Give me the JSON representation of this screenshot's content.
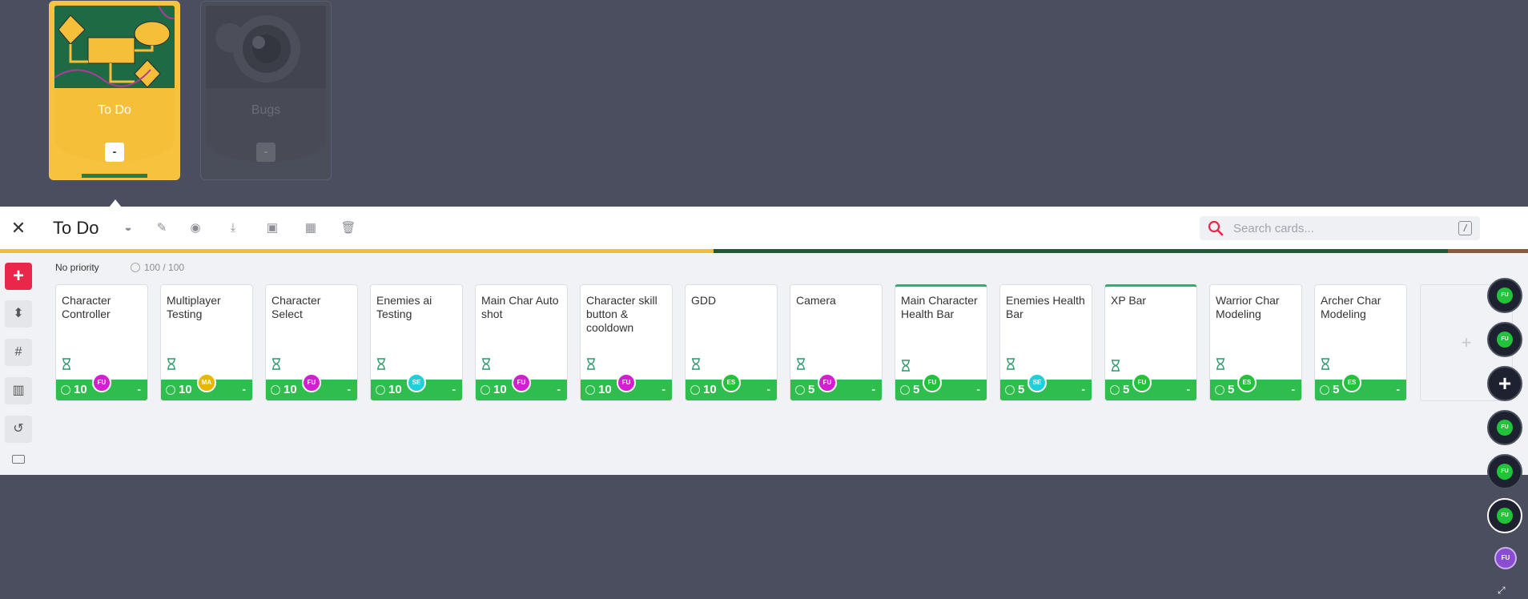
{
  "decks": [
    {
      "title": "To Do",
      "button": "-",
      "state": "selected"
    },
    {
      "title": "Bugs",
      "button": "-",
      "state": "inactive"
    }
  ],
  "header": {
    "title": "To Do",
    "close_icon": "close-icon",
    "tools": [
      "globe-icon",
      "pencil-icon",
      "eye-icon",
      "inbox-download-icon",
      "archive-icon",
      "calendar-icon",
      "trash-icon"
    ]
  },
  "search": {
    "placeholder": "Search cards...",
    "shortcut": "/"
  },
  "sidebar": [
    "add-icon",
    "sort-icon",
    "hash-icon",
    "chart-icon",
    "history-icon",
    "keyboard-icon"
  ],
  "lane": {
    "label": "No priority",
    "points": "100 / 100"
  },
  "cards": [
    {
      "title": "Character Controller",
      "points": "10",
      "avatar": "FU",
      "avatar_color": "#d21fd0",
      "dash": "-"
    },
    {
      "title": "Multiplayer Testing",
      "points": "10",
      "avatar": "MA",
      "avatar_color": "#e6b800",
      "dash": "-"
    },
    {
      "title": "Character Select",
      "points": "10",
      "avatar": "FU",
      "avatar_color": "#d21fd0",
      "dash": "-"
    },
    {
      "title": "Enemies ai Testing",
      "points": "10",
      "avatar": "SE",
      "avatar_color": "#1fd0d8",
      "dash": "-"
    },
    {
      "title": "Main Char Auto shot",
      "points": "10",
      "avatar": "FU",
      "avatar_color": "#d21fd0",
      "dash": "-"
    },
    {
      "title": "Character skill button & cooldown",
      "points": "10",
      "avatar": "FU",
      "avatar_color": "#d21fd0",
      "dash": "-"
    },
    {
      "title": "GDD",
      "points": "10",
      "avatar": "ES",
      "avatar_color": "#22c23a",
      "dash": "-"
    },
    {
      "title": "Camera",
      "points": "5",
      "avatar": "FU",
      "avatar_color": "#d21fd0",
      "dash": "-"
    },
    {
      "title": "Main Character Health Bar",
      "points": "5",
      "avatar": "FU",
      "avatar_color": "#22c23a",
      "dash": "-",
      "top_accent": true
    },
    {
      "title": "Enemies Health Bar",
      "points": "5",
      "avatar": "SE",
      "avatar_color": "#1fd0d8",
      "dash": "-"
    },
    {
      "title": "XP Bar",
      "points": "5",
      "avatar": "FU",
      "avatar_color": "#22c23a",
      "dash": "-",
      "top_accent": true
    },
    {
      "title": "Warrior Char Modeling",
      "points": "5",
      "avatar": "ES",
      "avatar_color": "#22c23a",
      "dash": "-"
    },
    {
      "title": "Archer Char Modeling",
      "points": "5",
      "avatar": "ES",
      "avatar_color": "#22c23a",
      "dash": "-"
    }
  ],
  "add_card": "+",
  "rail": [
    {
      "initials": "FU"
    },
    {
      "initials": "FU"
    },
    {
      "add": "+"
    },
    {
      "initials": "FU"
    },
    {
      "initials": "FU"
    },
    {
      "initials": "FU",
      "active": true
    },
    {
      "initials": "FU",
      "color": "#8a4cd0"
    }
  ],
  "colors": {
    "accent_red": "#e8274b",
    "card_footer_green": "#2fbe4e",
    "deck_yellow": "#f7c23e",
    "background": "#4a4e5f"
  }
}
